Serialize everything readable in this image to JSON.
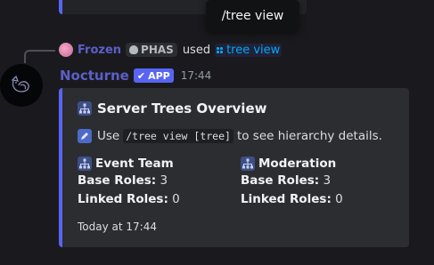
{
  "tooltip": {
    "text": "/tree view"
  },
  "reply": {
    "username": "Frozen",
    "clan_tag": "PHAS",
    "verb": "used",
    "command": "tree view"
  },
  "message": {
    "author": "Nocturne",
    "badge": "APP",
    "time": "17:44"
  },
  "embed": {
    "accent_color": "#5865f2",
    "title": "Server Trees Overview",
    "description": {
      "prefix": "Use",
      "code": "/tree view [tree]",
      "suffix": "to see hierarchy details."
    },
    "fields": [
      {
        "name": "Event Team",
        "base_label": "Base Roles:",
        "base_value": "3",
        "linked_label": "Linked Roles:",
        "linked_value": "0"
      },
      {
        "name": "Moderation",
        "base_label": "Base Roles:",
        "base_value": "3",
        "linked_label": "Linked Roles:",
        "linked_value": "0"
      }
    ],
    "footer": "Today at 17:44"
  },
  "icons": {
    "tree": "tree-icon",
    "info": "pencil-square-icon",
    "verified": "check-icon",
    "command": "slash-command-icon",
    "skull": "skull-icon"
  }
}
